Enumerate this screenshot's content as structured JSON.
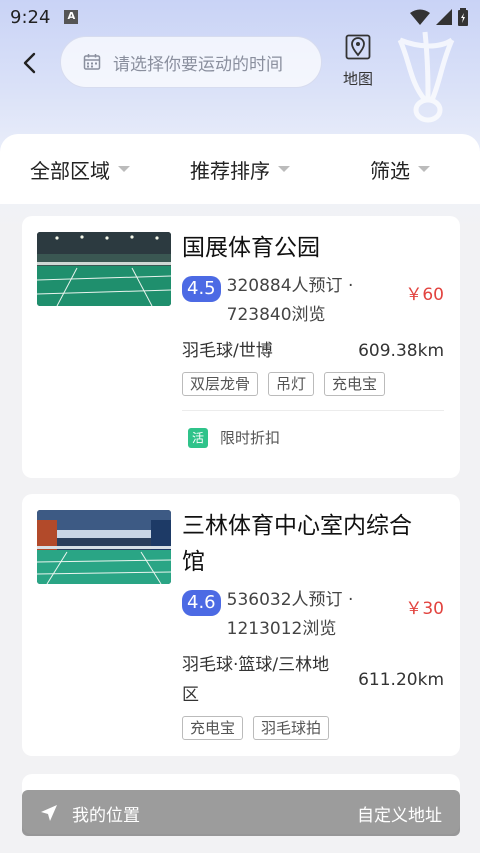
{
  "status": {
    "time": "9:24",
    "app_badge": "A"
  },
  "search": {
    "placeholder": "请选择你要运动的时间"
  },
  "header": {
    "map_label": "地图"
  },
  "filters": [
    {
      "label": "全部区域"
    },
    {
      "label": "推荐排序"
    },
    {
      "label": "筛选"
    }
  ],
  "venues": [
    {
      "name": "国展体育公园",
      "rating": "4.5",
      "bookings": "320884人预订 ·",
      "views": "723840浏览",
      "price": "￥60",
      "category": "羽毛球/世博",
      "distance": "609.38km",
      "tags": [
        "双层龙骨",
        "吊灯",
        "充电宝"
      ],
      "promo_badge": "活",
      "promo": "限时折扣"
    },
    {
      "name_line1": "三林体育中心室内综合",
      "name_line2": "馆",
      "rating": "4.6",
      "bookings": "536032人预订 ·",
      "views": "1213012浏览",
      "price": "￥30",
      "category_line1": "羽毛球·篮球/三林地",
      "category_line2": "区",
      "distance": "611.20km",
      "tags": [
        "充电宝",
        "羽毛球拍"
      ]
    }
  ],
  "bottom": {
    "my_location": "我的位置",
    "custom_address": "自定义地址"
  },
  "colors": {
    "accent": "#4c6ae4",
    "price": "#e2433f",
    "promo": "#2fc38a"
  }
}
